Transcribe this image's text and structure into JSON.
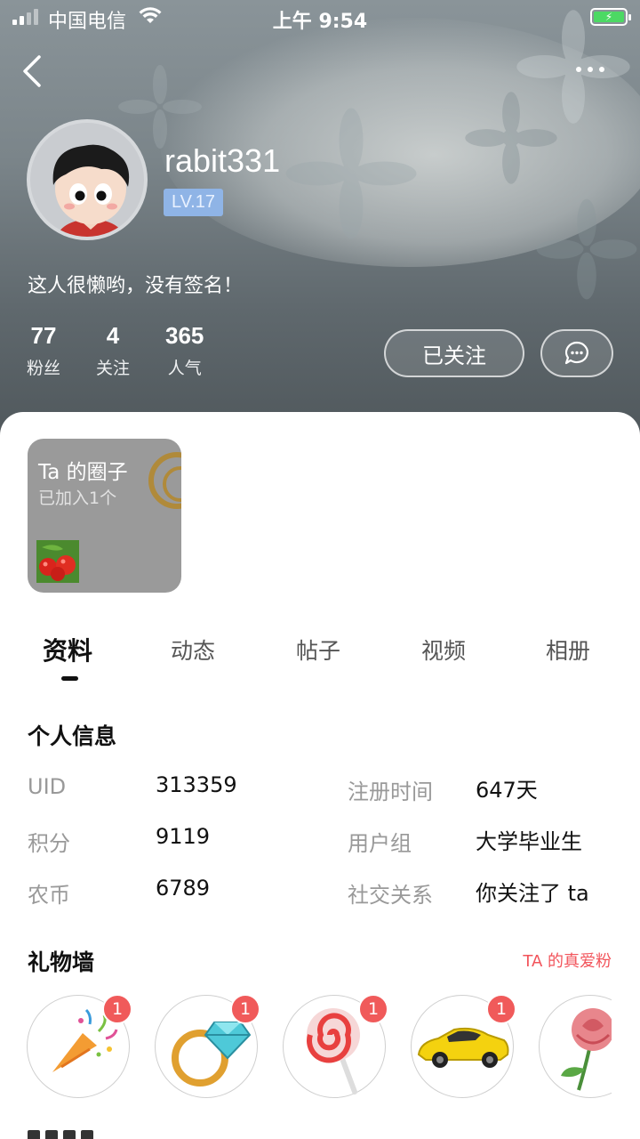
{
  "status_bar": {
    "carrier": "中国电信",
    "time": "上午 9:54"
  },
  "profile": {
    "username": "rabit331",
    "level": "LV.17",
    "signature": "这人很懒哟，没有签名！",
    "stats": [
      {
        "num": "77",
        "label": "粉丝"
      },
      {
        "num": "4",
        "label": "关注"
      },
      {
        "num": "365",
        "label": "人气"
      }
    ],
    "follow_label": "已关注"
  },
  "circle": {
    "title": "Ta 的圈子",
    "subtitle": "已加入1个"
  },
  "tabs": [
    "资料",
    "动态",
    "帖子",
    "视频",
    "相册"
  ],
  "personal_info": {
    "title": "个人信息",
    "rows": [
      {
        "label": "UID",
        "value": "313359"
      },
      {
        "label": "注册时间",
        "value": "647天"
      },
      {
        "label": "积分",
        "value": "9119"
      },
      {
        "label": "用户组",
        "value": "大学毕业生"
      },
      {
        "label": "农币",
        "value": "6789"
      },
      {
        "label": "社交关系",
        "value": "你关注了 ta"
      }
    ]
  },
  "gifts": {
    "title": "礼物墙",
    "fans_link": "TA 的真爱粉",
    "items": [
      {
        "icon": "party-popper-icon",
        "count": "1"
      },
      {
        "icon": "diamond-ring-icon",
        "count": "1"
      },
      {
        "icon": "lollipop-icon",
        "count": "1"
      },
      {
        "icon": "sports-car-icon",
        "count": "1"
      },
      {
        "icon": "rose-icon"
      }
    ]
  },
  "colors": {
    "accent_red": "#f05a5a",
    "level_badge": "#8fb4e6",
    "battery_green": "#4cd964"
  }
}
